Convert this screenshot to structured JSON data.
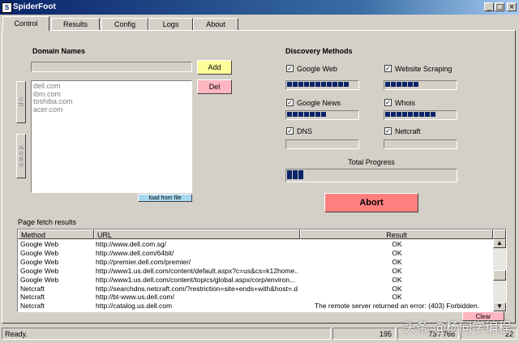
{
  "window": {
    "title": "SpiderFoot",
    "min_glyph": "_",
    "max_glyph": "□",
    "close_glyph": "×"
  },
  "tabs": [
    {
      "label": "Control",
      "active": true
    },
    {
      "label": "Results"
    },
    {
      "label": "Config"
    },
    {
      "label": "Logs"
    },
    {
      "label": "About"
    }
  ],
  "domains": {
    "heading": "Domain Names",
    "input_value": "",
    "add_label": "Add",
    "del_label": "Del",
    "up_label": "u p",
    "down_label": "d o w n",
    "list": [
      "dell.com",
      "ibm.com",
      "toshiba.com",
      "acer.com"
    ],
    "load_label": "load from file"
  },
  "discovery": {
    "heading": "Discovery Methods",
    "methods": [
      {
        "label": "Google Web",
        "checked": true,
        "progress": 0.85
      },
      {
        "label": "Website Scraping",
        "checked": true,
        "progress": 0.5
      },
      {
        "label": "Google News",
        "checked": true,
        "progress": 0.55
      },
      {
        "label": "Whois",
        "checked": true,
        "progress": 0.7
      },
      {
        "label": "DNS",
        "checked": true,
        "progress": 0.0
      },
      {
        "label": "Netcraft",
        "checked": true,
        "progress": 0.0
      }
    ],
    "total_label": "Total Progress",
    "total_progress": 0.1,
    "abort_label": "Abort"
  },
  "results": {
    "heading": "Page fetch results",
    "columns": [
      "Method",
      "URL",
      "Result"
    ],
    "rows": [
      [
        "Google Web",
        "http://www.dell.com.sg/",
        "OK"
      ],
      [
        "Google Web",
        "http://www.dell.com/64bit/",
        "OK"
      ],
      [
        "Google Web",
        "http://premier.dell.com/premier/",
        "OK"
      ],
      [
        "Google Web",
        "http://www1.us.dell.com/content/default.aspx?c=us&cs=k12home...",
        "OK"
      ],
      [
        "Google Web",
        "http://www1.us.dell.com/content/topics/global.aspx/corp/environ...",
        "OK"
      ],
      [
        "Netcraft",
        "http://searchdns.netcraft.com/?restriction=site+ends+with&host=.d...",
        "OK"
      ],
      [
        "Netcraft",
        "http://bt-www.us.dell.com/",
        "OK"
      ],
      [
        "Netcraft",
        "http://catalog.us.dell.com",
        "The remote server returned an error: (403) Forbidden."
      ]
    ],
    "clear_label": "Clear"
  },
  "status": {
    "text": "Ready.",
    "count1": "195",
    "count2": "73 / 766",
    "count3": "22"
  },
  "watermark": "头条 @杨同学编程",
  "colors": {
    "title_bar": "#0a246a",
    "progress_fill": "#0a246a",
    "add_button": "#ffff99",
    "del_button": "#ffb6c1",
    "abort_button": "#ff7f7f",
    "load_button": "#a6d8f0",
    "clear_button": "#ffb6c1"
  }
}
